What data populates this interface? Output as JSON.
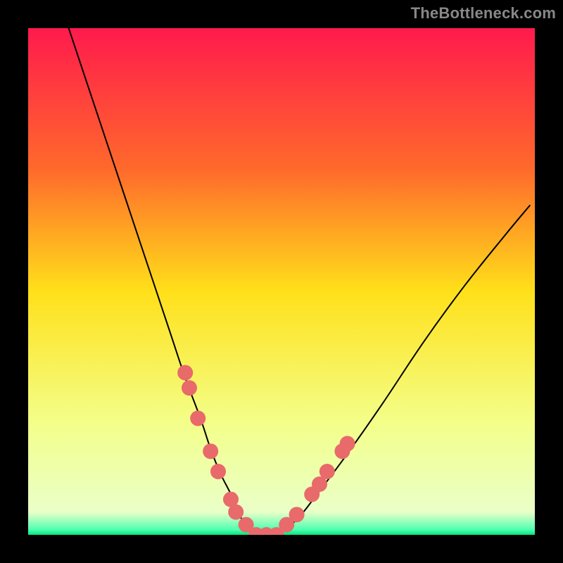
{
  "watermark": "TheBottleneck.com",
  "chart_data": {
    "type": "line",
    "title": "",
    "xlabel": "",
    "ylabel": "",
    "xlim": [
      0,
      100
    ],
    "ylim": [
      0,
      100
    ],
    "grid": false,
    "legend": false,
    "background_gradient": {
      "top_color": "#ff1a4d",
      "mid_upper_color": "#ff8a26",
      "mid_color": "#ffe01a",
      "mid_lower_color": "#f5ff7a",
      "bottom_color": "#00e57a"
    },
    "series": [
      {
        "name": "bottleneck-v-curve",
        "type": "line",
        "color": "#000000",
        "width": 2,
        "x": [
          8,
          12,
          16,
          20,
          24,
          28,
          31,
          34,
          36,
          38,
          40,
          41,
          43,
          45,
          47,
          49,
          53,
          57,
          63,
          70,
          78,
          86,
          94,
          99
        ],
        "y": [
          100,
          88,
          76,
          64,
          52,
          40,
          31,
          23,
          17,
          12,
          8,
          5,
          2,
          0,
          0,
          0,
          3,
          8,
          16,
          26,
          38,
          49,
          59,
          65
        ]
      },
      {
        "name": "left-markers",
        "type": "scatter",
        "color": "#e86a6a",
        "radius": 11,
        "x": [
          31.0,
          31.8,
          33.5,
          36.0,
          37.5,
          40.0,
          41.0,
          43.0
        ],
        "y": [
          32.0,
          29.0,
          23.0,
          16.5,
          12.5,
          7.0,
          4.5,
          2.0
        ]
      },
      {
        "name": "bottom-markers",
        "type": "scatter",
        "color": "#e86a6a",
        "radius": 11,
        "x": [
          45.0,
          47.0,
          49.0
        ],
        "y": [
          0.0,
          0.0,
          0.0
        ]
      },
      {
        "name": "right-markers",
        "type": "scatter",
        "color": "#e86a6a",
        "radius": 11,
        "x": [
          51.0,
          53.0,
          56.0,
          57.5,
          59.0,
          62.0,
          63.0
        ],
        "y": [
          2.0,
          4.0,
          8.0,
          10.0,
          12.5,
          16.5,
          18.0
        ]
      }
    ]
  }
}
